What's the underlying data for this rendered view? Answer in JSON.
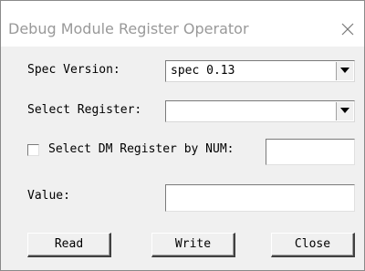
{
  "window": {
    "title": "Debug Module Register Operator",
    "close_icon": "close-icon"
  },
  "spec_version": {
    "label": "Spec Version:",
    "value": "spec 0.13"
  },
  "select_register": {
    "label": "Select Register:",
    "value": ""
  },
  "select_by_num": {
    "label": "Select DM Register by NUM:",
    "checked": false,
    "value": ""
  },
  "value_field": {
    "label": "Value:",
    "value": ""
  },
  "buttons": {
    "read": "Read",
    "write": "Write",
    "close": "Close"
  }
}
